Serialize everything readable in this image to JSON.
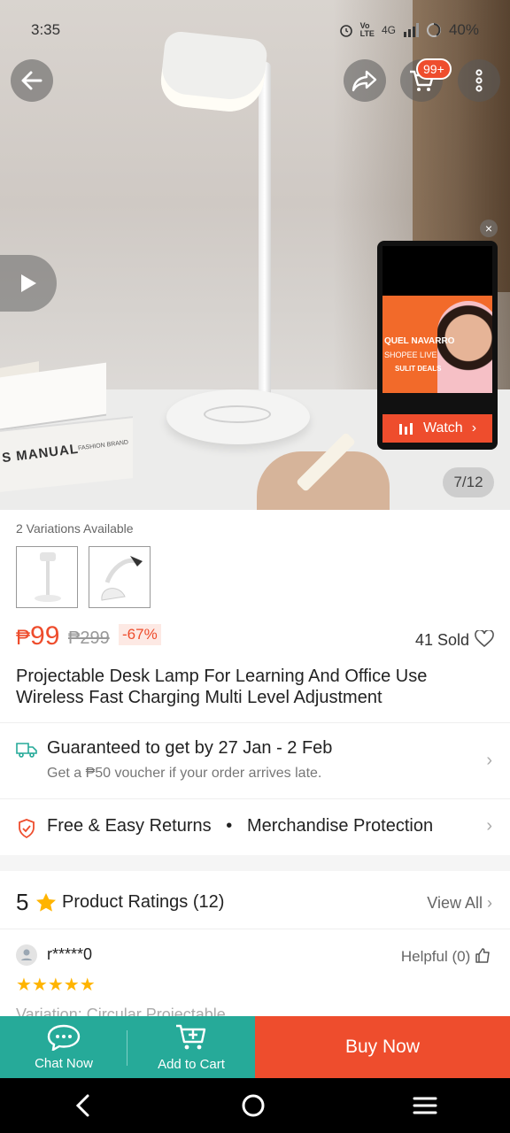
{
  "status_bar": {
    "time": "3:35",
    "network": "4G",
    "battery": "40%"
  },
  "gallery": {
    "counter": "7/12",
    "cart_badge": "99+",
    "book_text": "S MANUAL",
    "book_small_text": "FASHION BRAND"
  },
  "live": {
    "host_name": "QUEL NAVARRO",
    "brand": "SHOPEE LIVE",
    "tagline": "SULIT DEALS",
    "watch_label": "Watch"
  },
  "product": {
    "variations_label": "2 Variations Available",
    "price_currency": "₱",
    "price": "99",
    "original_price": "₱299",
    "discount": "-67%",
    "sold": "41 Sold",
    "title": "Projectable Desk Lamp For Learning And Office Use Wireless Fast Charging Multi Level Adjustment"
  },
  "shipping": {
    "main": "Guaranteed to get by 27 Jan - 2 Feb",
    "sub": "Get a ₱50 voucher if your order arrives late."
  },
  "returns": {
    "left": "Free & Easy Returns",
    "separator": "•",
    "right": "Merchandise Protection"
  },
  "ratings": {
    "score": "5",
    "label": "Product Ratings (12)",
    "view_all": "View All",
    "review": {
      "user": "r*****0",
      "helpful": "Helpful (0)",
      "stars": "★★★★★",
      "variation": "Variation: Circular Projectable"
    }
  },
  "bottom_bar": {
    "chat": "Chat Now",
    "add_to_cart": "Add to Cart",
    "buy_now": "Buy Now"
  },
  "colors": {
    "brand_orange": "#ee4d2d",
    "teal": "#26aa99",
    "star": "#ffb400"
  }
}
